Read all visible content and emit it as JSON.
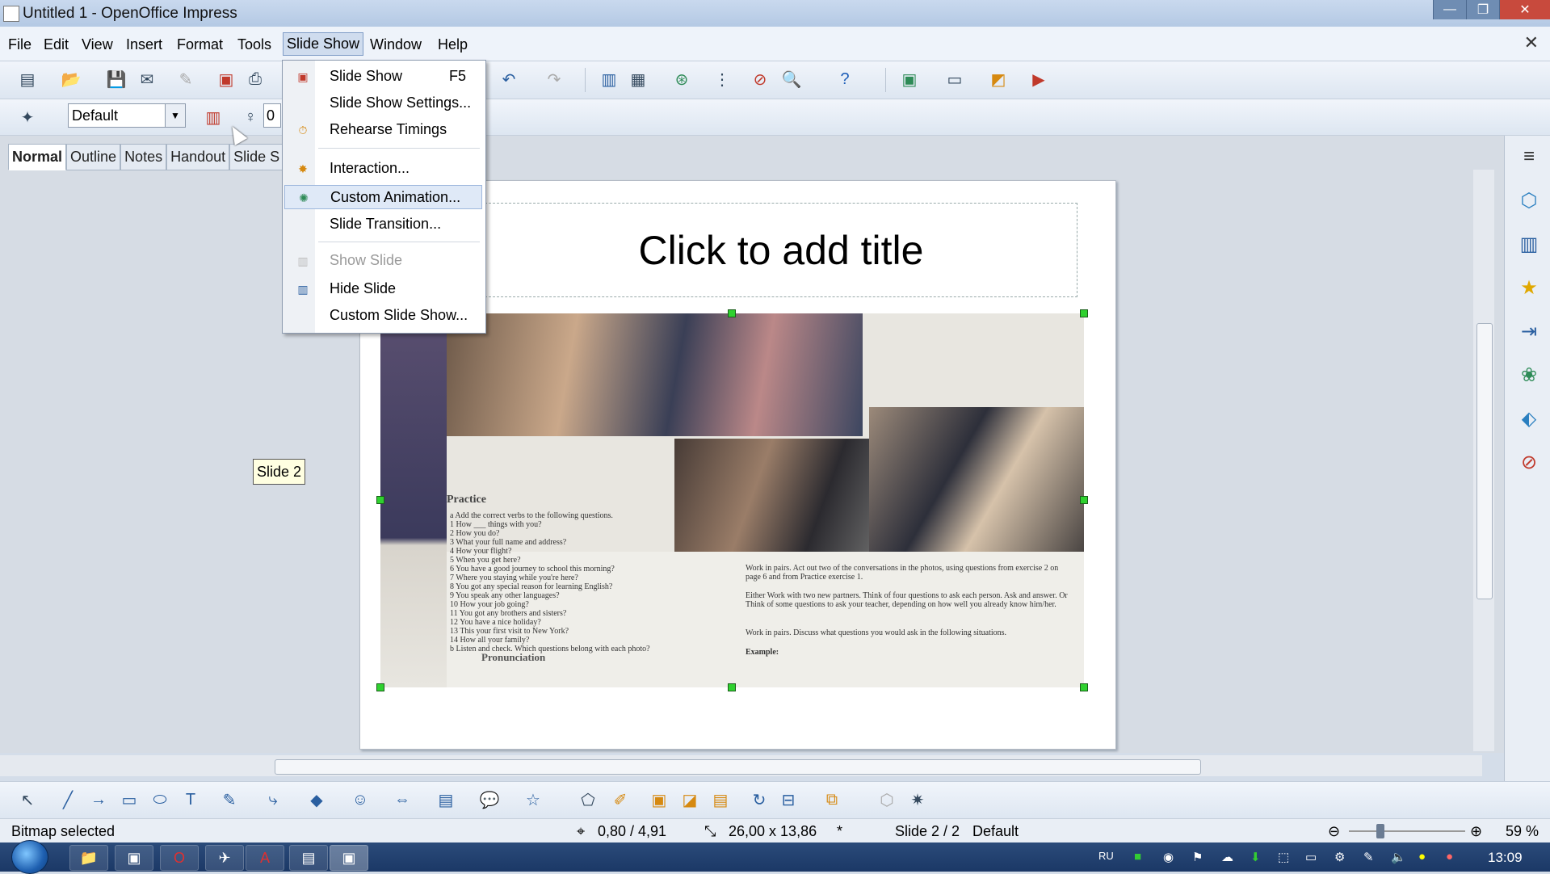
{
  "window": {
    "title": "Untitled 1 - OpenOffice Impress",
    "minimize": "—",
    "restore": "❐",
    "close": "✕"
  },
  "menubar": {
    "items": [
      "File",
      "Edit",
      "View",
      "Insert",
      "Format",
      "Tools",
      "Slide Show",
      "Window",
      "Help"
    ],
    "active": "Slide Show",
    "close": "✕"
  },
  "toolbar2": {
    "style_value": "Default",
    "number_value": "0"
  },
  "view_tabs": [
    "Normal",
    "Outline",
    "Notes",
    "Handout",
    "Slide S"
  ],
  "dropdown": {
    "items": [
      {
        "label": "Slide Show",
        "shortcut": "F5",
        "icon": "slideshow-icon"
      },
      {
        "label": "Slide Show Settings...",
        "icon": ""
      },
      {
        "label": "Rehearse Timings",
        "icon": "stopwatch-icon"
      },
      {
        "label": "Interaction...",
        "icon": "interaction-icon"
      },
      {
        "label": "Custom Animation...",
        "icon": "animation-icon",
        "highlighted": true
      },
      {
        "label": "Slide Transition...",
        "icon": ""
      },
      {
        "label": "Show Slide",
        "icon": "show-slide-icon",
        "disabled": true
      },
      {
        "label": "Hide Slide",
        "icon": "hide-slide-icon"
      },
      {
        "label": "Custom Slide Show...",
        "icon": ""
      }
    ]
  },
  "slide": {
    "title_placeholder": "Click to add title",
    "tooltip": "Slide 2",
    "bitmap_text": {
      "practice_heading": "Practice",
      "pronunciation_heading": "Pronunciation",
      "exercise2": "Work in pairs. Act out two of the conversations in the photos, using questions from exercise 2 on page 6 and from Practice exercise 1.",
      "exercise3": "Either Work with two new partners. Think of four questions to ask each person. Ask and answer. Or Think of some questions to ask your teacher, depending on how well you already know him/her.",
      "exercise4": "Work in pairs. Discuss what questions you would ask in the following situations.",
      "example_label": "Example:",
      "q1_lines": [
        "a  Add the correct verbs to the following questions.",
        "1  How ___ things with you?",
        "2  How you do?",
        "3  What your full name and address?",
        "4  How your flight?",
        "5  When you get here?",
        "6  You have a good journey to school this morning?",
        "7  Where you staying while you're here?",
        "8  You got any special reason for learning English?",
        "9  You speak any other languages?",
        "10  How your job going?",
        "11  You got any brothers and sisters?",
        "12  You have a nice holiday?",
        "13  This your first visit to New York?",
        "14  How all your family?",
        "b  Listen and check. Which questions belong with each photo?"
      ]
    }
  },
  "statusbar": {
    "message": "Bitmap selected",
    "position": "0,80 / 4,91",
    "size": "26,00 x 13,86",
    "modified": "*",
    "slide": "Slide 2 / 2",
    "layout": "Default",
    "zoom": "59 %"
  },
  "taskbar": {
    "lang": "RU",
    "clock": "13:09"
  }
}
